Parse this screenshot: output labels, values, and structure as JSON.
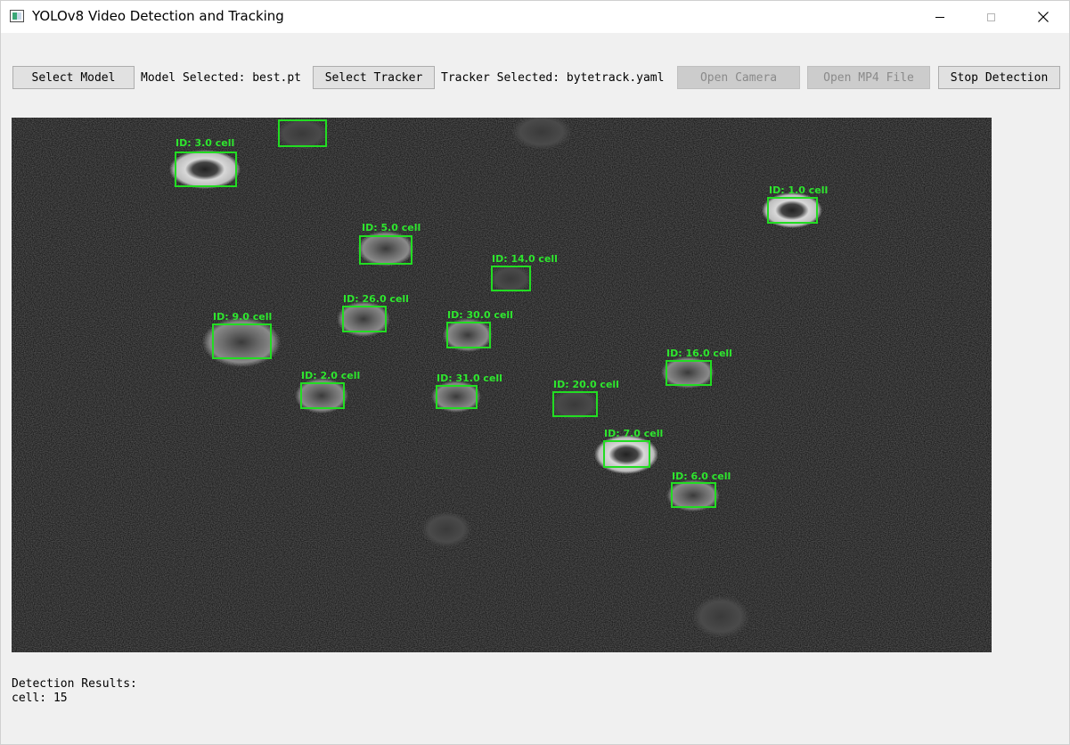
{
  "window": {
    "title": "YOLOv8 Video Detection and Tracking"
  },
  "toolbar": {
    "select_model_label": "Select Model",
    "model_selected_text": "Model Selected: best.pt",
    "select_tracker_label": "Select Tracker",
    "tracker_selected_text": "Tracker Selected: bytetrack.yaml",
    "open_camera_label": "Open Camera",
    "open_mp4_label": "Open MP4 File",
    "stop_detection_label": "Stop Detection"
  },
  "detections": [
    {
      "label": "ID: 3.0 cell"
    },
    {
      "label": ""
    },
    {
      "label": "ID: 1.0 cell"
    },
    {
      "label": "ID: 5.0 cell"
    },
    {
      "label": "ID: 14.0 cell"
    },
    {
      "label": "ID: 26.0 cell"
    },
    {
      "label": "ID: 30.0 cell"
    },
    {
      "label": "ID: 9.0 cell"
    },
    {
      "label": "ID: 16.0 cell"
    },
    {
      "label": "ID: 2.0 cell"
    },
    {
      "label": "ID: 31.0 cell"
    },
    {
      "label": "ID: 20.0 cell"
    },
    {
      "label": "ID: 7.0 cell"
    },
    {
      "label": "ID: 6.0 cell"
    }
  ],
  "results": {
    "heading": "Detection Results:",
    "summary": "cell: 15"
  },
  "colors": {
    "box": "#22dd22",
    "label": "#2ee62e"
  }
}
